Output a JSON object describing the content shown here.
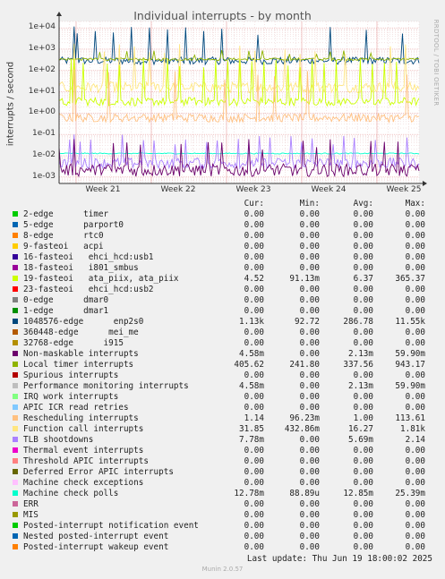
{
  "side_label": "RRDTOOL / TOBI OETIKER",
  "footer": {
    "last_update": "Last update: Thu Jun 19 18:00:02 2025",
    "munin": "Munin 2.0.57"
  },
  "legend_header": {
    "cur": "Cur:",
    "min": "Min:",
    "avg": "Avg:",
    "max": "Max:"
  },
  "legend": [
    {
      "name": "2-edge      timer",
      "color": "#00cc00",
      "cur": "0.00",
      "min": "0.00",
      "avg": "0.00",
      "max": "0.00"
    },
    {
      "name": "5-edge      parport0",
      "color": "#0066b3",
      "cur": "0.00",
      "min": "0.00",
      "avg": "0.00",
      "max": "0.00"
    },
    {
      "name": "8-edge      rtc0",
      "color": "#ff8000",
      "cur": "0.00",
      "min": "0.00",
      "avg": "0.00",
      "max": "0.00"
    },
    {
      "name": "9-fasteoi   acpi",
      "color": "#ffcc00",
      "cur": "0.00",
      "min": "0.00",
      "avg": "0.00",
      "max": "0.00"
    },
    {
      "name": "16-fasteoi   ehci_hcd:usb1",
      "color": "#330099",
      "cur": "0.00",
      "min": "0.00",
      "avg": "0.00",
      "max": "0.00"
    },
    {
      "name": "18-fasteoi   i801_smbus",
      "color": "#990099",
      "cur": "0.00",
      "min": "0.00",
      "avg": "0.00",
      "max": "0.00"
    },
    {
      "name": "19-fasteoi   ata_piix, ata_piix",
      "color": "#ccff00",
      "cur": "4.52",
      "min": "91.13m",
      "avg": "6.37",
      "max": "365.37"
    },
    {
      "name": "23-fasteoi   ehci_hcd:usb2",
      "color": "#ff0000",
      "cur": "0.00",
      "min": "0.00",
      "avg": "0.00",
      "max": "0.00"
    },
    {
      "name": "0-edge      dmar0",
      "color": "#808080",
      "cur": "0.00",
      "min": "0.00",
      "avg": "0.00",
      "max": "0.00"
    },
    {
      "name": "1-edge      dmar1",
      "color": "#008f00",
      "cur": "0.00",
      "min": "0.00",
      "avg": "0.00",
      "max": "0.00"
    },
    {
      "name": "1048576-edge      enp2s0",
      "color": "#00487d",
      "cur": "1.13k",
      "min": "92.72",
      "avg": "286.78",
      "max": "11.55k"
    },
    {
      "name": "360448-edge      mei_me",
      "color": "#b35a00",
      "cur": "0.00",
      "min": "0.00",
      "avg": "0.00",
      "max": "0.00"
    },
    {
      "name": "32768-edge      i915",
      "color": "#b38f00",
      "cur": "0.00",
      "min": "0.00",
      "avg": "0.00",
      "max": "0.00"
    },
    {
      "name": "Non-maskable interrupts",
      "color": "#6b006b",
      "cur": "4.58m",
      "min": "0.00",
      "avg": "2.13m",
      "max": "59.90m"
    },
    {
      "name": "Local timer interrupts",
      "color": "#8fb300",
      "cur": "405.62",
      "min": "241.80",
      "avg": "337.56",
      "max": "943.17"
    },
    {
      "name": "Spurious interrupts",
      "color": "#b30000",
      "cur": "0.00",
      "min": "0.00",
      "avg": "0.00",
      "max": "0.00"
    },
    {
      "name": "Performance monitoring interrupts",
      "color": "#bebebe",
      "cur": "4.58m",
      "min": "0.00",
      "avg": "2.13m",
      "max": "59.90m"
    },
    {
      "name": "IRQ work interrupts",
      "color": "#80ff80",
      "cur": "0.00",
      "min": "0.00",
      "avg": "0.00",
      "max": "0.00"
    },
    {
      "name": "APIC ICR read retries",
      "color": "#80c9ff",
      "cur": "0.00",
      "min": "0.00",
      "avg": "0.00",
      "max": "0.00"
    },
    {
      "name": "Rescheduling interrupts",
      "color": "#ffc080",
      "cur": "1.14",
      "min": "96.23m",
      "avg": "1.00",
      "max": "113.61"
    },
    {
      "name": "Function call interrupts",
      "color": "#ffe680",
      "cur": "31.85",
      "min": "432.86m",
      "avg": "16.27",
      "max": "1.81k"
    },
    {
      "name": "TLB shootdowns",
      "color": "#aa80ff",
      "cur": "7.78m",
      "min": "0.00",
      "avg": "5.69m",
      "max": "2.14"
    },
    {
      "name": "Thermal event interrupts",
      "color": "#ee00cc",
      "cur": "0.00",
      "min": "0.00",
      "avg": "0.00",
      "max": "0.00"
    },
    {
      "name": "Threshold APIC interrupts",
      "color": "#ff8080",
      "cur": "0.00",
      "min": "0.00",
      "avg": "0.00",
      "max": "0.00"
    },
    {
      "name": "Deferred Error APIC interrupts",
      "color": "#666600",
      "cur": "0.00",
      "min": "0.00",
      "avg": "0.00",
      "max": "0.00"
    },
    {
      "name": "Machine check exceptions",
      "color": "#ffbfff",
      "cur": "0.00",
      "min": "0.00",
      "avg": "0.00",
      "max": "0.00"
    },
    {
      "name": "Machine check polls",
      "color": "#00ffcc",
      "cur": "12.78m",
      "min": "88.89u",
      "avg": "12.85m",
      "max": "25.39m"
    },
    {
      "name": "ERR",
      "color": "#cc6699",
      "cur": "0.00",
      "min": "0.00",
      "avg": "0.00",
      "max": "0.00"
    },
    {
      "name": "MIS",
      "color": "#999900",
      "cur": "0.00",
      "min": "0.00",
      "avg": "0.00",
      "max": "0.00"
    },
    {
      "name": "Posted-interrupt notification event",
      "color": "#00cc00",
      "cur": "0.00",
      "min": "0.00",
      "avg": "0.00",
      "max": "0.00"
    },
    {
      "name": "Nested posted-interrupt event",
      "color": "#0066b3",
      "cur": "0.00",
      "min": "0.00",
      "avg": "0.00",
      "max": "0.00"
    },
    {
      "name": "Posted-interrupt wakeup event",
      "color": "#ff8000",
      "cur": "0.00",
      "min": "0.00",
      "avg": "0.00",
      "max": "0.00"
    }
  ],
  "chart_data": {
    "type": "line",
    "title": "Individual interrupts - by month",
    "ylabel": "interrupts / second",
    "xlabel": "",
    "yscale": "log",
    "ylim": [
      0.0005,
      20000
    ],
    "y_ticks": [
      {
        "base": "1e-03",
        "value": 0.001
      },
      {
        "base": "1e-02",
        "value": 0.01
      },
      {
        "base": "1e-01",
        "value": 0.1
      },
      {
        "base": "1e+00",
        "value": 1
      },
      {
        "base": "1e+01",
        "value": 10
      },
      {
        "base": "1e+02",
        "value": 100
      },
      {
        "base": "1e+03",
        "value": 1000
      },
      {
        "base": "1e+04",
        "value": 10000
      }
    ],
    "x_ticks": [
      "Week 21",
      "Week 22",
      "Week 23",
      "Week 24",
      "Week 25"
    ],
    "grid": true,
    "series": [
      {
        "name": "1048576-edge      enp2s0",
        "color": "#00487d",
        "baseline": 286.78,
        "spike_max": 11550,
        "spread": 0.35,
        "spike_every": 12
      },
      {
        "name": "Local timer interrupts",
        "color": "#8fb300",
        "baseline": 337.56,
        "spike_max": 943.17,
        "spread": 0.12,
        "spike_every": 9
      },
      {
        "name": "Function call interrupts",
        "color": "#ffe680",
        "baseline": 16.27,
        "spike_max": 1810,
        "spread": 0.5,
        "spike_every": 10
      },
      {
        "name": "19-fasteoi   ata_piix, ata_piix",
        "color": "#ccff00",
        "baseline": 3.5,
        "spike_max": 365.37,
        "spread": 0.4,
        "spike_every": 8
      },
      {
        "name": "Rescheduling interrupts",
        "color": "#ffc080",
        "baseline": 0.6,
        "spike_max": 113.61,
        "spread": 0.4,
        "spike_every": 11
      },
      {
        "name": "Machine check polls",
        "color": "#00ffcc",
        "baseline": 0.01285,
        "spike_max": 0.02539,
        "spread": 0.05,
        "spike_every": 0
      },
      {
        "name": "TLB shootdowns",
        "color": "#aa80ff",
        "baseline": 0.0045,
        "spike_max": 0.1,
        "spread": 0.5,
        "spike_every": 7
      },
      {
        "name": "Non-maskable interrupts",
        "color": "#6b006b",
        "baseline": 0.0021,
        "spike_max": 0.0599,
        "spread": 0.6,
        "spike_every": 9
      }
    ]
  }
}
